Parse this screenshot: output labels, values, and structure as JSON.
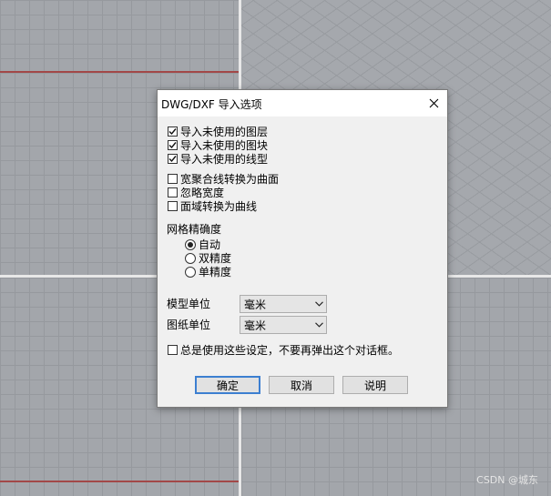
{
  "dialog": {
    "title": "DWG/DXF 导入选项",
    "close_icon": "close-icon",
    "import_options": [
      {
        "label": "导入未使用的图层",
        "checked": true
      },
      {
        "label": "导入未使用的图块",
        "checked": true
      },
      {
        "label": "导入未使用的线型",
        "checked": true
      }
    ],
    "convert_options": [
      {
        "label": "宽聚合线转换为曲面",
        "checked": false
      },
      {
        "label": "忽略宽度",
        "checked": false
      },
      {
        "label": "面域转换为曲线",
        "checked": false
      }
    ],
    "mesh_precision": {
      "heading": "网格精确度",
      "options": [
        {
          "label": "自动",
          "selected": true
        },
        {
          "label": "双精度",
          "selected": false
        },
        {
          "label": "单精度",
          "selected": false
        }
      ]
    },
    "model_units": {
      "label": "模型单位",
      "value": "毫米"
    },
    "paper_units": {
      "label": "图纸单位",
      "value": "毫米"
    },
    "always_use": {
      "label": "总是使用这些设定，不要再弹出这个对话框。",
      "checked": false
    },
    "buttons": {
      "ok": "确定",
      "cancel": "取消",
      "help": "说明"
    }
  },
  "watermark": "CSDN @城东",
  "colors": {
    "accent": "#3c7fd1",
    "axis_red": "#a24848",
    "dialog_bg": "#f0f0f0"
  }
}
